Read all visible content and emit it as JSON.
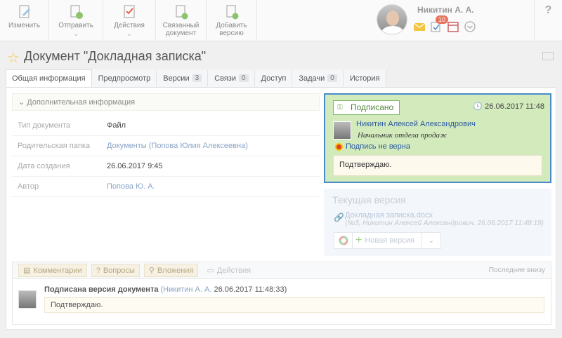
{
  "toolbar": {
    "edit": "Изменить",
    "send": "Отправить",
    "actions": "Действия",
    "linked_doc": "Связанный документ",
    "add_version": "Добавить версию"
  },
  "user": {
    "name": "Никитин А. А.",
    "tasks_badge": "10"
  },
  "help": "?",
  "document": {
    "title": "Документ \"Докладная записка\""
  },
  "tabs": [
    {
      "label": "Общая информация",
      "count": ""
    },
    {
      "label": "Предпросмотр",
      "count": ""
    },
    {
      "label": "Версии",
      "count": "3"
    },
    {
      "label": "Связи",
      "count": "0"
    },
    {
      "label": "Доступ",
      "count": ""
    },
    {
      "label": "Задачи",
      "count": "0"
    },
    {
      "label": "История",
      "count": ""
    }
  ],
  "additional_info": "Дополнительная информация",
  "properties": [
    {
      "key": "Тип документа",
      "value": "Файл"
    },
    {
      "key": "Родительская папка",
      "value": "Документы (Попова Юлия Алексеевна)"
    },
    {
      "key": "Дата создания",
      "value": "26.06.2017 9:45"
    },
    {
      "key": "Автор",
      "value": "Попова Ю. А."
    }
  ],
  "signature": {
    "status": "Подписано",
    "datetime": "26.06.2017 11:48",
    "signer": "Никитин Алексей Александрович",
    "role": "Начальник отдела продаж",
    "invalid": "Подпись не верна",
    "comment": "Подтверждаю."
  },
  "current_version": {
    "heading": "Текущая версия",
    "file": "Докладная записка.docx",
    "meta": "(№3, Никитин Алексей Александрович, 26.06.2017 11:48:19)",
    "new_version": "Новая версия"
  },
  "comments": {
    "tabs": [
      "Комментарии",
      "Вопросы",
      "Вложения",
      "Действия"
    ],
    "latest_label": "Последние внизу",
    "entry_title": "Подписана версия документа",
    "entry_author": "(Никитин А. А.",
    "entry_time": "26.06.2017 11:48:33)",
    "entry_text": "Подтверждаю."
  },
  "colors": {
    "signature_bg": "#d2eabc",
    "signature_border": "#4a8cc9",
    "link": "#2c5aa0",
    "accent_green": "#6aa653"
  }
}
